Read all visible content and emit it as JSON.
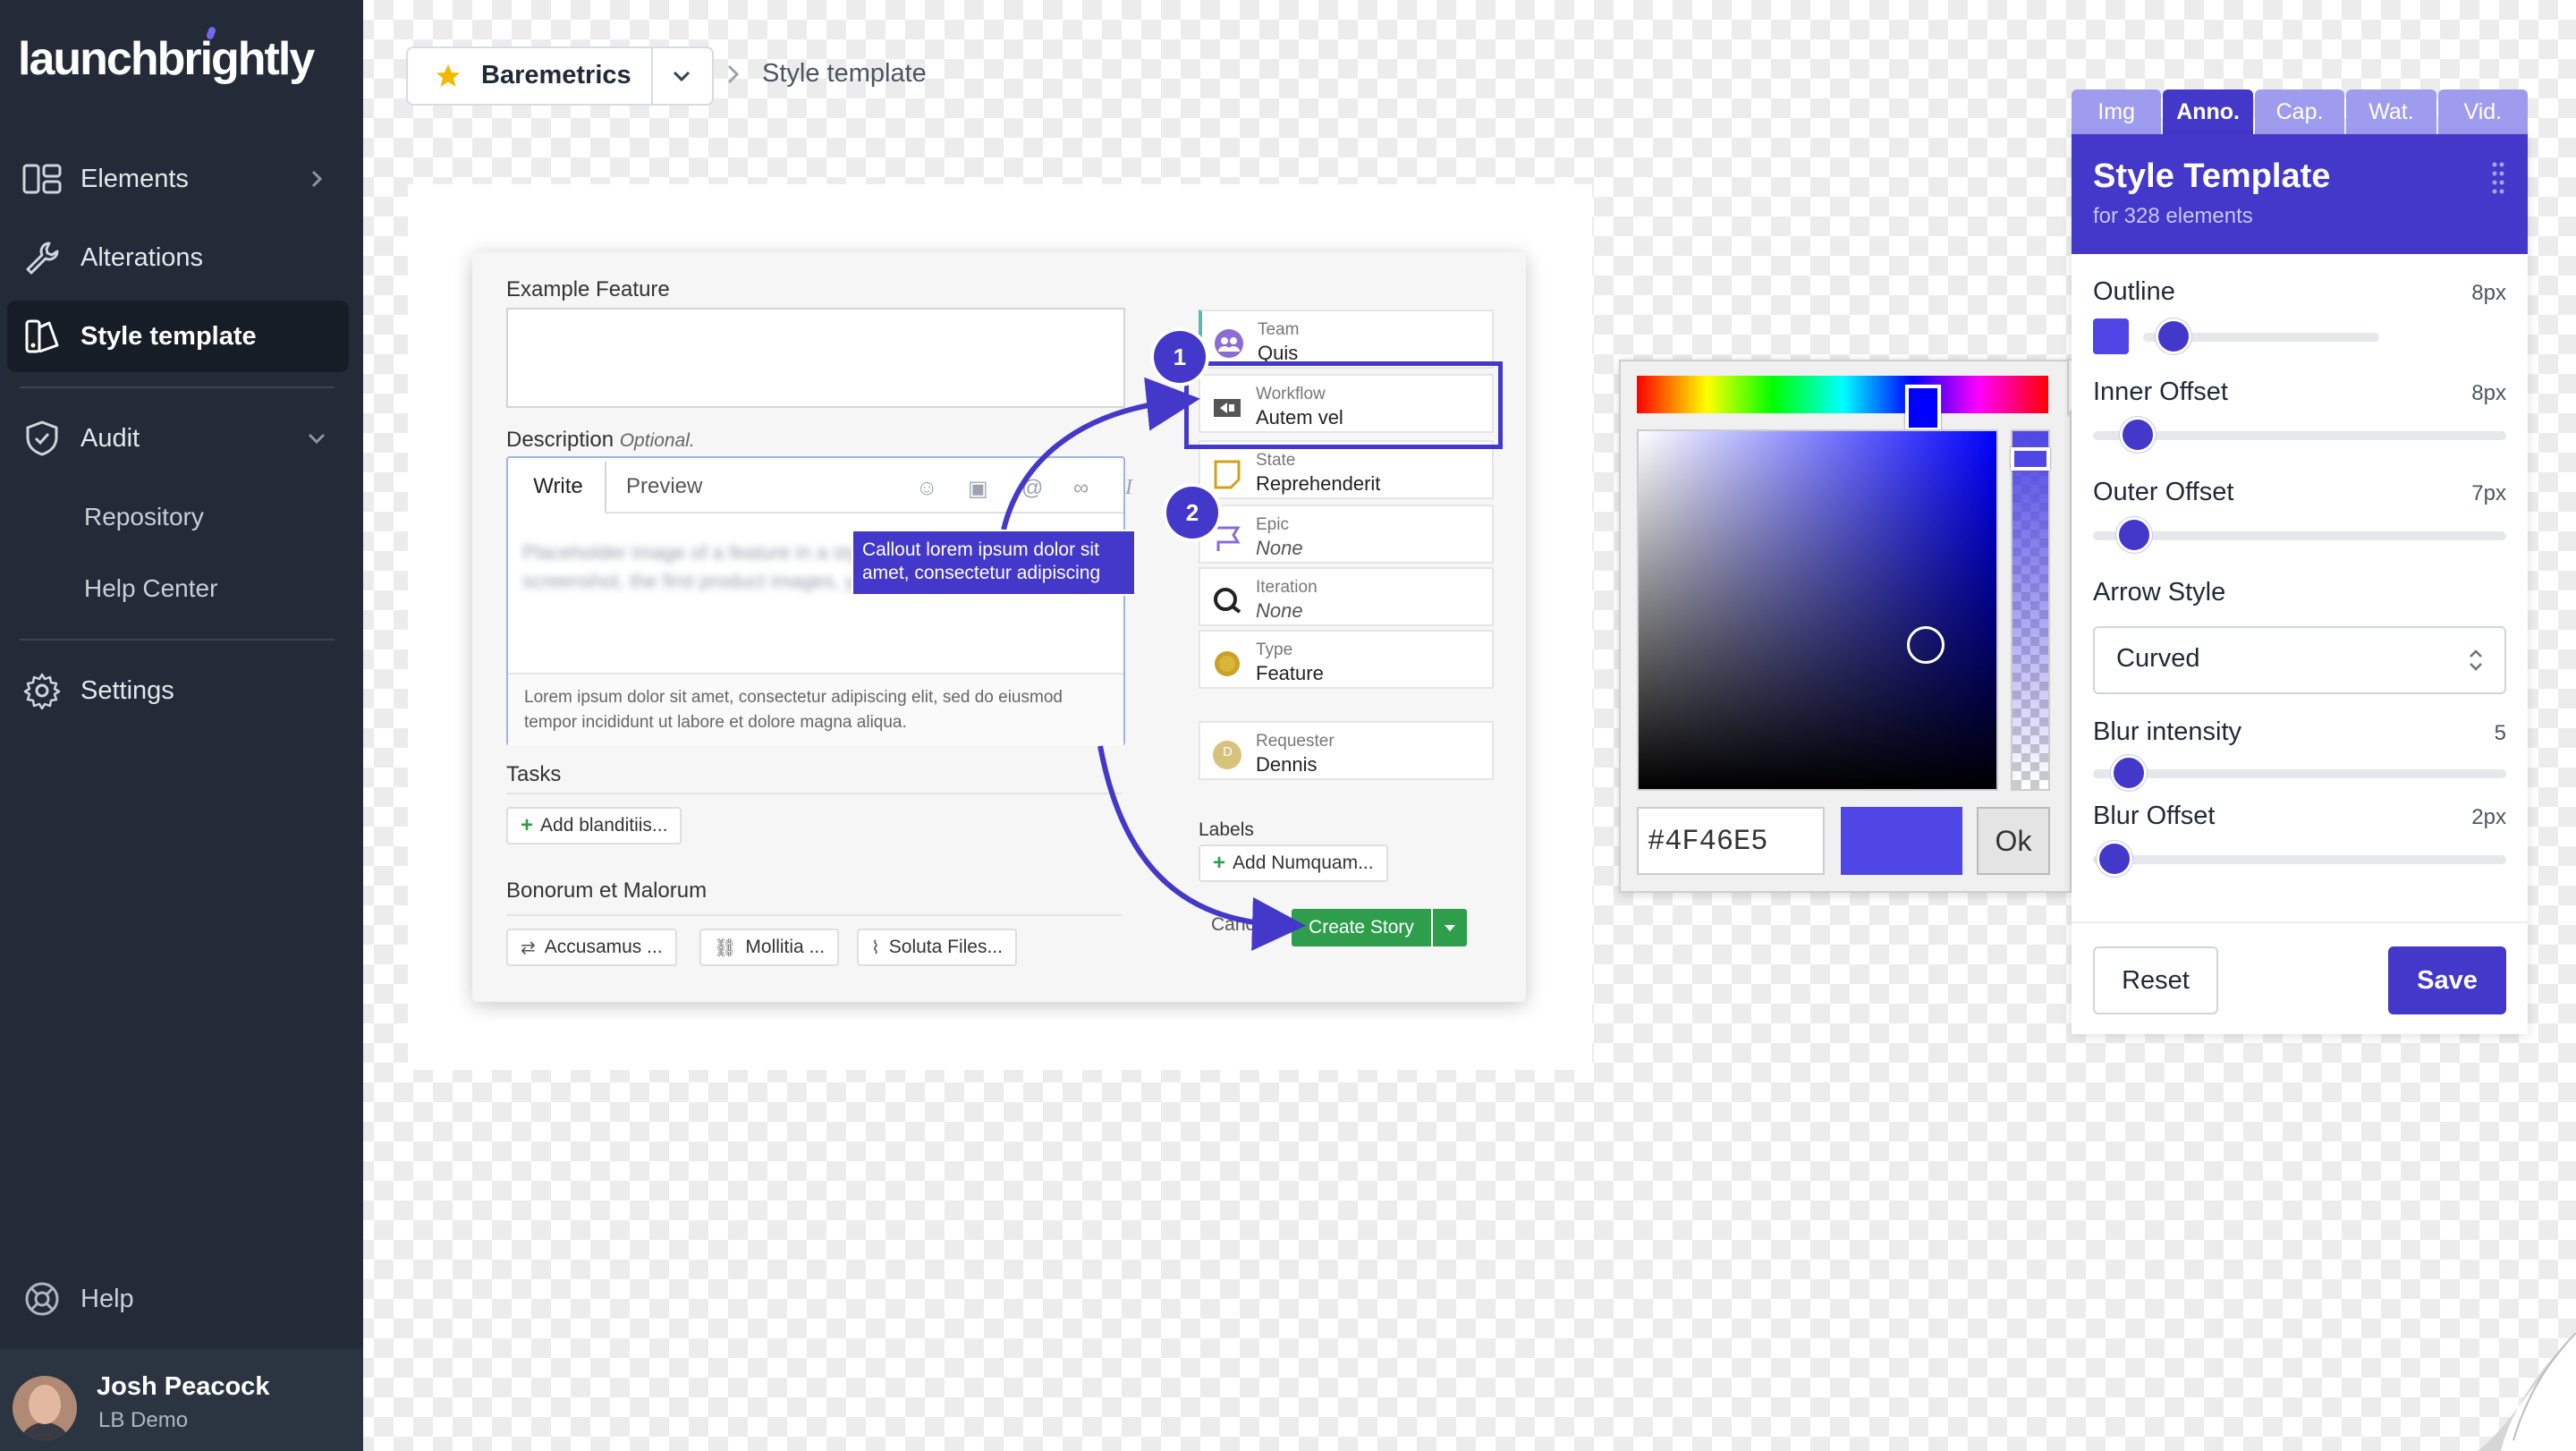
{
  "sidebar": {
    "logo": "launchbrightly",
    "nav": [
      {
        "label": "Elements",
        "icon": "elements-icon"
      },
      {
        "label": "Alterations",
        "icon": "wrench-icon"
      },
      {
        "label": "Style template",
        "icon": "style-template-icon",
        "active": true
      },
      {
        "label": "Audit",
        "icon": "shield-check-icon"
      }
    ],
    "audit_sub": [
      "Repository",
      "Help Center"
    ],
    "settings_label": "Settings",
    "help_label": "Help",
    "user": {
      "name": "Josh Peacock",
      "org": "LB Demo"
    }
  },
  "breadcrumb": {
    "project": "Baremetrics",
    "current": "Style template"
  },
  "story": {
    "feature_label": "Example Feature",
    "description_label": "Description",
    "description_optional": "Optional.",
    "tab_write": "Write",
    "tab_preview": "Preview",
    "placeholder_blurred": "Placeholder image of a feature in a style. Once you've run a screenshot, the first product images, you can flip through those.)",
    "helper_text": "Lorem ipsum dolor sit amet, consectetur adipiscing elit, sed do eiusmod tempor incididunt ut labore et dolore magna aliqua.",
    "tasks_label": "Tasks",
    "add_task": "Add blanditiis...",
    "section2_label": "Bonorum et Malorum",
    "chips": [
      "Accusamus ...",
      "Mollitia ...",
      "Soluta Files..."
    ],
    "fields": [
      {
        "title": "Team",
        "value": "Quis"
      },
      {
        "title": "Workflow",
        "value": "Autem vel"
      },
      {
        "title": "State",
        "value": "Reprehenderit"
      },
      {
        "title": "Epic",
        "value": "None"
      },
      {
        "title": "Iteration",
        "value": "None"
      },
      {
        "title": "Type",
        "value": "Feature"
      },
      {
        "title": "Requester",
        "value": "Dennis",
        "initial": "D"
      }
    ],
    "labels_label": "Labels",
    "add_label": "Add Numquam...",
    "cancel_label": "Cancel",
    "create_label": "Create Story"
  },
  "annotations": {
    "badge1": "1",
    "badge2": "2",
    "callout": "Callout lorem ipsum dolor sit amet, consectetur adipiscing",
    "color": "#4338CA"
  },
  "picker": {
    "hex": "#4F46E5",
    "ok": "Ok",
    "selected_color": "#4F46E5"
  },
  "panel": {
    "tabs": [
      "Img",
      "Anno.",
      "Cap.",
      "Wat.",
      "Vid."
    ],
    "active_tab": "Anno.",
    "title": "Style Template",
    "subtitle": "for 328 elements",
    "outline": {
      "label": "Outline",
      "value": "8px"
    },
    "inner_offset": {
      "label": "Inner Offset",
      "value": "8px"
    },
    "outer_offset": {
      "label": "Outer Offset",
      "value": "7px"
    },
    "arrow_style": {
      "label": "Arrow Style",
      "value": "Curved"
    },
    "blur_intensity": {
      "label": "Blur intensity",
      "value": "5"
    },
    "blur_offset": {
      "label": "Blur Offset",
      "value": "2px"
    },
    "reset": "Reset",
    "save": "Save",
    "accent": "#4338CA"
  }
}
